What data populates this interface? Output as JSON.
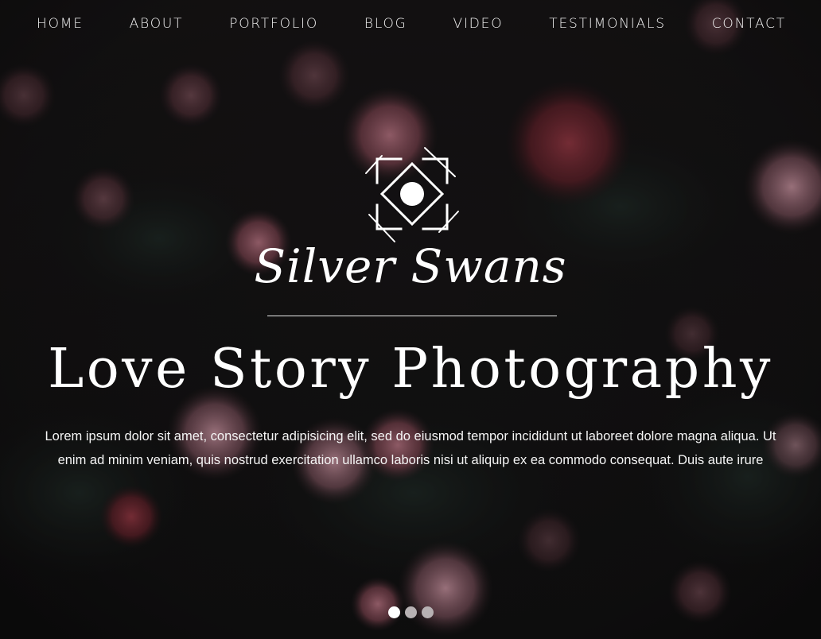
{
  "nav": {
    "items": [
      {
        "label": "HOME"
      },
      {
        "label": "ABOUT"
      },
      {
        "label": "PORTFOLIO"
      },
      {
        "label": "BLOG"
      },
      {
        "label": "VIDEO"
      },
      {
        "label": "TESTIMONIALS"
      },
      {
        "label": "CONTACT"
      }
    ]
  },
  "hero": {
    "brand_name": "Silver Swans",
    "logo_icon": "camera-frame-logo-icon",
    "headline": "Love Story Photography",
    "description": "Lorem ipsum dolor sit amet, consectetur adipisicing elit, sed do eiusmod tempor incididunt ut laboreet dolore magna aliqua. Ut enim ad minim veniam, quis nostrud exercitation ullamco laboris nisi ut aliquip ex ea commodo consequat. Duis aute irure",
    "background": "dark floral photo with pink and red roses",
    "slider": {
      "slide_count": 3,
      "active_index": 0
    }
  },
  "colors": {
    "text": "#ffffff",
    "background": "#141313",
    "dot_inactive": "#b7b1b3",
    "dot_active": "#ffffff"
  }
}
